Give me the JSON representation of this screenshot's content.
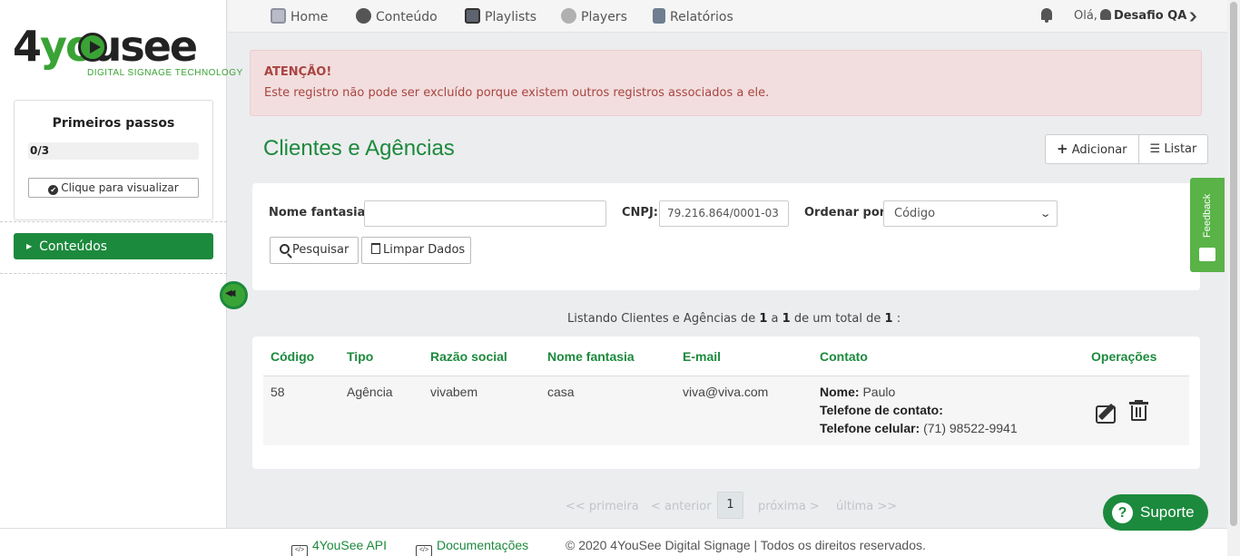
{
  "sidebar": {
    "logo_text": "4yousee",
    "logo_sub": "DIGITAL SIGNAGE TECHNOLOGY",
    "first_steps": {
      "title": "Primeiros passos",
      "progress_text": "0/3",
      "progress_fraction": 0,
      "button_label": "Clique para visualizar"
    },
    "menu": [
      {
        "label": "Conteúdos",
        "active": true
      }
    ]
  },
  "nav": {
    "items": [
      {
        "label": "Home",
        "icon": "home-icon"
      },
      {
        "label": "Conteúdo",
        "icon": "film-reel-icon"
      },
      {
        "label": "Playlists",
        "icon": "playlist-icon"
      },
      {
        "label": "Players",
        "icon": "player-icon"
      },
      {
        "label": "Relatórios",
        "icon": "report-icon"
      }
    ],
    "greeting": "Olá,",
    "user_name": "Desafio QA"
  },
  "alert": {
    "title": "ATENÇÃO!",
    "message": "Este registro não pode ser excluído porque existem outros registros associados a ele."
  },
  "page": {
    "title": "Clientes e Agências",
    "add_label": "Adicionar",
    "list_label": "Listar"
  },
  "filter": {
    "name_label": "Nome fantasia:",
    "name_value": "",
    "cnpj_label": "CNPJ:",
    "cnpj_value": "79.216.864/0001-03",
    "order_label": "Ordenar por:",
    "order_value": "Código",
    "search_label": "Pesquisar",
    "clear_label": "Limpar Dados"
  },
  "listing": {
    "prefix": "Listando Clientes e Agências de",
    "from": "1",
    "middle": "a",
    "to": "1",
    "total_text": "de um total de",
    "total": "1",
    "suffix": ":"
  },
  "table": {
    "headers": [
      "Código",
      "Tipo",
      "Razão social",
      "Nome fantasia",
      "E-mail",
      "Contato",
      "Operações"
    ],
    "rows": [
      {
        "codigo": "58",
        "tipo": "Agência",
        "razao": "vivabem",
        "fantasia": "casa",
        "email": "viva@viva.com",
        "contato_nome_label": "Nome:",
        "contato_nome": "Paulo",
        "telefone_label": "Telefone de contato:",
        "telefone": "",
        "celular_label": "Telefone celular:",
        "celular": "(71) 98522-9941"
      }
    ]
  },
  "pagination": {
    "first": "<< primeira",
    "prev": "< anterior",
    "current": "1",
    "next": "próxima >",
    "last": "última >>"
  },
  "footer": {
    "api_label": "4YouSee API",
    "docs_label": "Documentações",
    "copyright": "© 2020 4YouSee Digital Signage | Todos os direitos reservados."
  },
  "feedback_label": "Feedback",
  "support_label": "Suporte",
  "colors": {
    "brand_green": "#1c8a3d",
    "alert_bg": "#f2dede",
    "alert_text": "#a94442"
  }
}
